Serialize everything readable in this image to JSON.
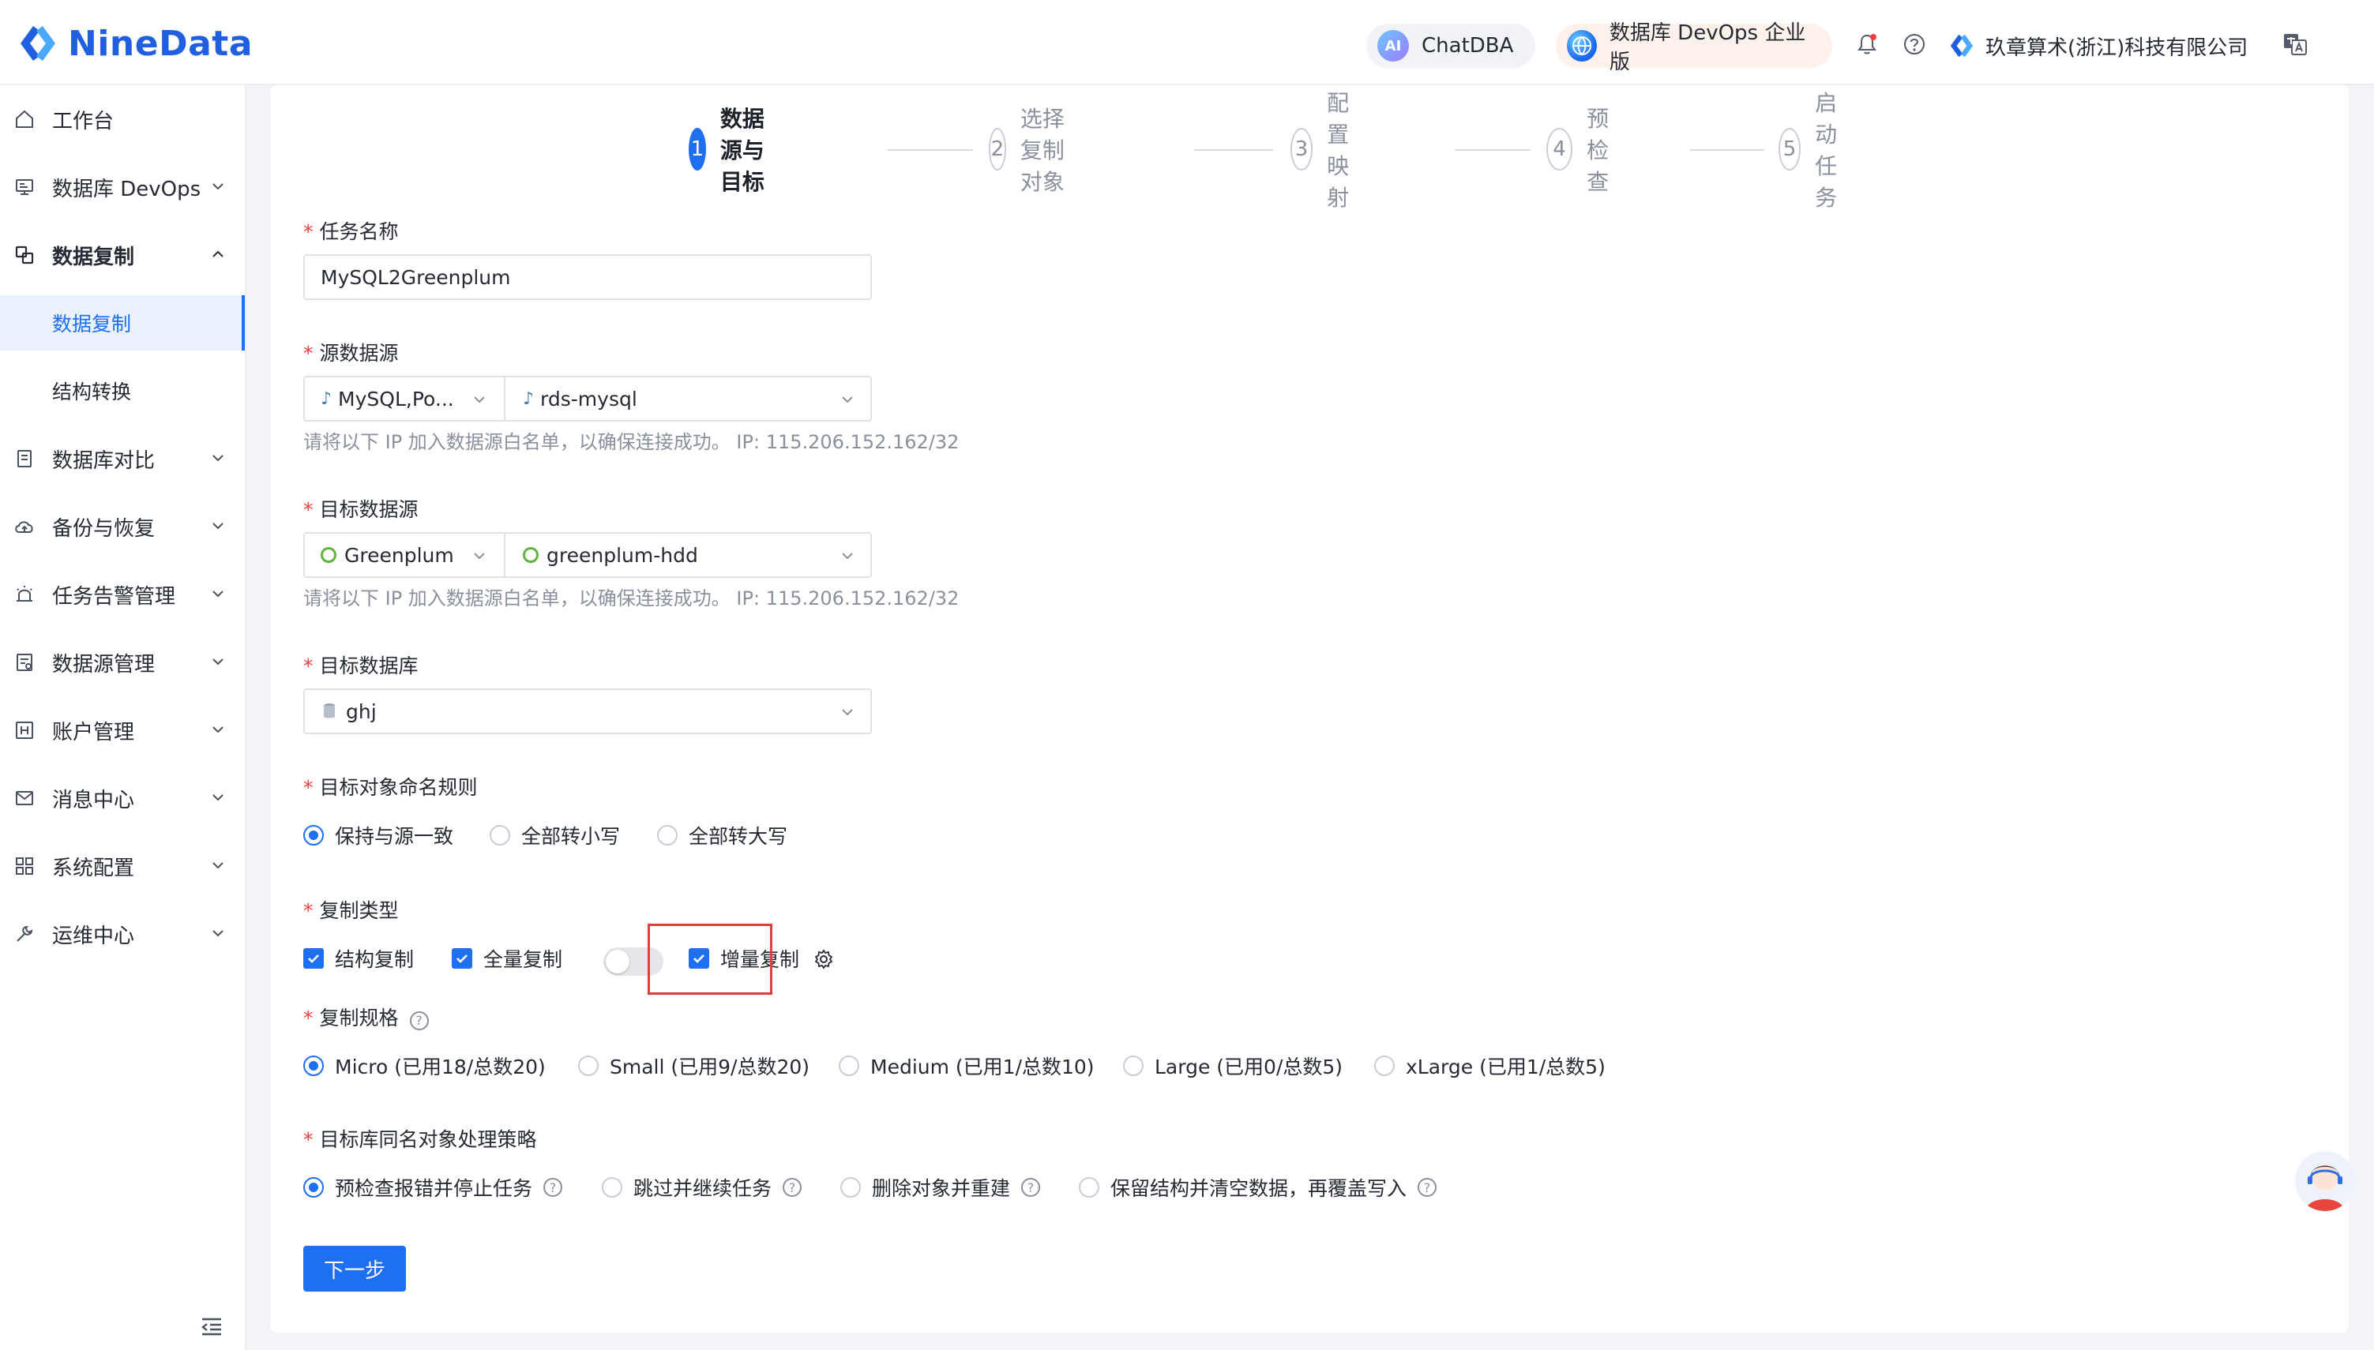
{
  "app": {
    "logo_text": "NineData",
    "chatdba_label": "ChatDBA",
    "chatdba_badge": "AI",
    "edition_label": "数据库 DevOps 企业版",
    "company_name": "玖章算术(浙江)科技有限公司"
  },
  "sidebar": {
    "items": [
      {
        "label": "工作台"
      },
      {
        "label": "数据库 DevOps"
      },
      {
        "label": "数据复制"
      },
      {
        "label": "数据复制"
      },
      {
        "label": "结构转换"
      },
      {
        "label": "数据库对比"
      },
      {
        "label": "备份与恢复"
      },
      {
        "label": "任务告警管理"
      },
      {
        "label": "数据源管理"
      },
      {
        "label": "账户管理"
      },
      {
        "label": "消息中心"
      },
      {
        "label": "系统配置"
      },
      {
        "label": "运维中心"
      }
    ]
  },
  "steps": [
    {
      "num": "1",
      "label": "数据源与目标"
    },
    {
      "num": "2",
      "label": "选择复制对象"
    },
    {
      "num": "3",
      "label": "配置映射"
    },
    {
      "num": "4",
      "label": "预检查"
    },
    {
      "num": "5",
      "label": "启动任务"
    }
  ],
  "form": {
    "task_name_label": "任务名称",
    "task_name_value": "MySQL2Greenplum",
    "source_label": "源数据源",
    "source_type": "MySQL,Po...",
    "source_instance": "rds-mysql",
    "source_hint": "请将以下 IP 加入数据源白名单，以确保连接成功。 IP: 115.206.152.162/32",
    "target_label": "目标数据源",
    "target_type": "Greenplum",
    "target_instance": "greenplum-hdd",
    "target_hint": "请将以下 IP 加入数据源白名单，以确保连接成功。 IP: 115.206.152.162/32",
    "target_db_label": "目标数据库",
    "target_db_value": "ghj",
    "naming_label": "目标对象命名规则",
    "naming_options": [
      "保持与源一致",
      "全部转小写",
      "全部转大写"
    ],
    "copy_type_label": "复制类型",
    "copy_types": [
      "结构复制",
      "全量复制",
      "增量复制"
    ],
    "spec_label": "复制规格",
    "spec_options": [
      "Micro (已用18/总数20)",
      "Small (已用9/总数20)",
      "Medium (已用1/总数10)",
      "Large (已用0/总数5)",
      "xLarge (已用1/总数5)"
    ],
    "strategy_label": "目标库同名对象处理策略",
    "strategy_options": [
      "预检查报错并停止任务",
      "跳过并继续任务",
      "删除对象并重建",
      "保留结构并清空数据，再覆盖写入"
    ],
    "next_label": "下一步"
  },
  "colors": {
    "primary": "#1f6ff2",
    "required": "#f53f3f",
    "highlight": "#e63c3c",
    "logo": "#1f5fe0"
  }
}
